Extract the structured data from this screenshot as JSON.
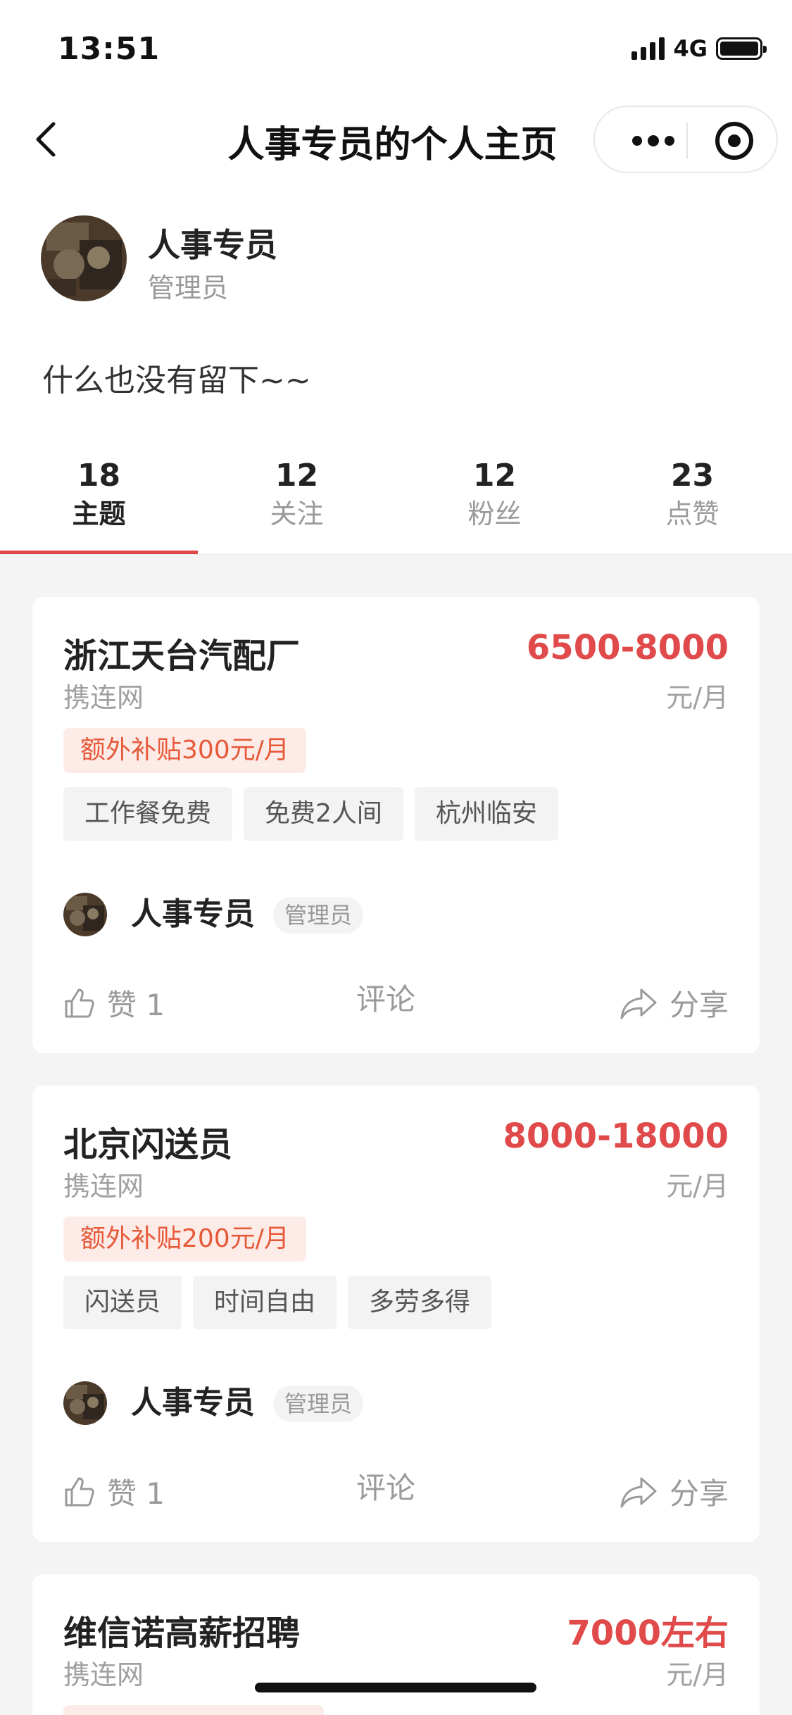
{
  "status_bar": {
    "time": "13:51",
    "network": "4G"
  },
  "nav": {
    "title": "人事专员的个人主页"
  },
  "profile": {
    "name": "人事专员",
    "role": "管理员",
    "bio": "什么也没有留下~~"
  },
  "stats": [
    {
      "num": "18",
      "label": "主题"
    },
    {
      "num": "12",
      "label": "关注"
    },
    {
      "num": "12",
      "label": "粉丝"
    },
    {
      "num": "23",
      "label": "点赞"
    }
  ],
  "posts": [
    {
      "title": "浙江天台汽配厂",
      "salary": "6500-8000",
      "company": "携连网",
      "unit": "元/月",
      "bonus": "额外补贴300元/月",
      "tags": [
        "工作餐免费",
        "免费2人间",
        "杭州临安"
      ],
      "poster_name": "人事专员",
      "poster_role": "管理员",
      "like_label": "赞 1",
      "comment_label": "评论",
      "share_label": "分享"
    },
    {
      "title": "北京闪送员",
      "salary": "8000-18000",
      "company": "携连网",
      "unit": "元/月",
      "bonus": "额外补贴200元/月",
      "tags": [
        "闪送员",
        "时间自由",
        "多劳多得"
      ],
      "poster_name": "人事专员",
      "poster_role": "管理员",
      "like_label": "赞 1",
      "comment_label": "评论",
      "share_label": "分享"
    },
    {
      "title": "维信诺高薪招聘",
      "salary": "7000左右",
      "company": "携连网",
      "unit": "元/月"
    }
  ],
  "colors": {
    "accent": "#e04747",
    "bonus_text": "#e65a3a",
    "bonus_bg": "#fdebe7"
  },
  "icons": [
    "back-icon",
    "more-icon",
    "target-icon",
    "thumbs-up-icon",
    "share-icon",
    "signal-icon",
    "battery-icon"
  ]
}
